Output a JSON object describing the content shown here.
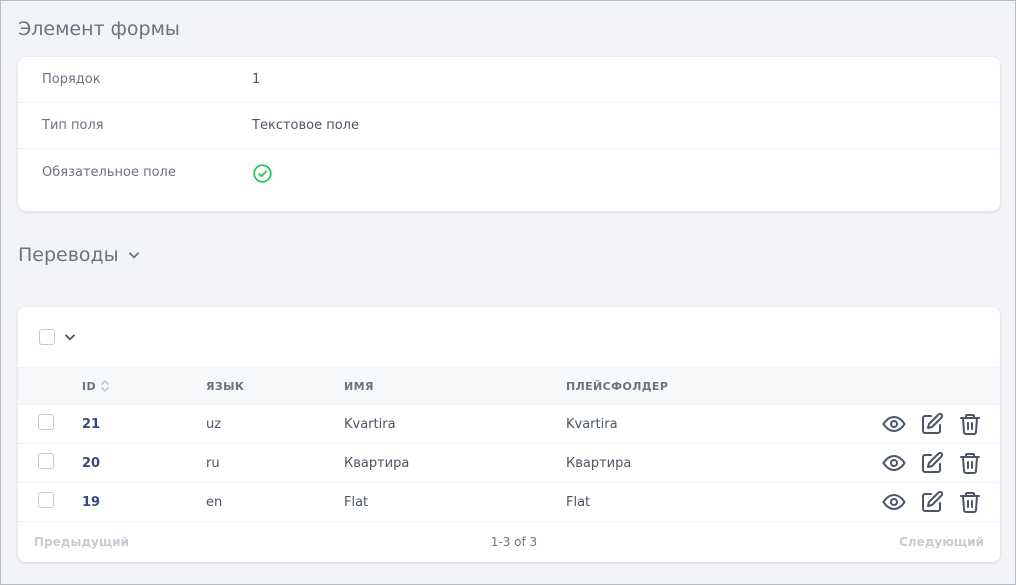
{
  "form_element": {
    "title": "Элемент формы",
    "fields": [
      {
        "label": "Порядок",
        "value": "1"
      },
      {
        "label": "Тип поля",
        "value": "Текстовое поле"
      },
      {
        "label": "Обязательное поле",
        "value": "",
        "icon": "check-circle-icon"
      }
    ]
  },
  "translations": {
    "title": "Переводы",
    "columns": {
      "id": "ID",
      "lang": "ЯЗЫК",
      "name": "ИМЯ",
      "placeholder": "ПЛЕЙСФОЛДЕР"
    },
    "rows": [
      {
        "id": "21",
        "lang": "uz",
        "name": "Kvartira",
        "placeholder": "Kvartira"
      },
      {
        "id": "20",
        "lang": "ru",
        "name": "Квартира",
        "placeholder": "Квартира"
      },
      {
        "id": "19",
        "lang": "en",
        "name": "Flat",
        "placeholder": "Flat"
      }
    ],
    "pagination": {
      "prev": "Предыдущий",
      "info": "1-3 of 3",
      "next": "Следующий"
    }
  },
  "colors": {
    "accent_id": "#334a7a",
    "success": "#22c55e",
    "icon": "#4b5563"
  },
  "icons": [
    "chevron-down-icon",
    "sort-icon",
    "eye-icon",
    "edit-icon",
    "trash-icon",
    "check-circle-icon"
  ]
}
